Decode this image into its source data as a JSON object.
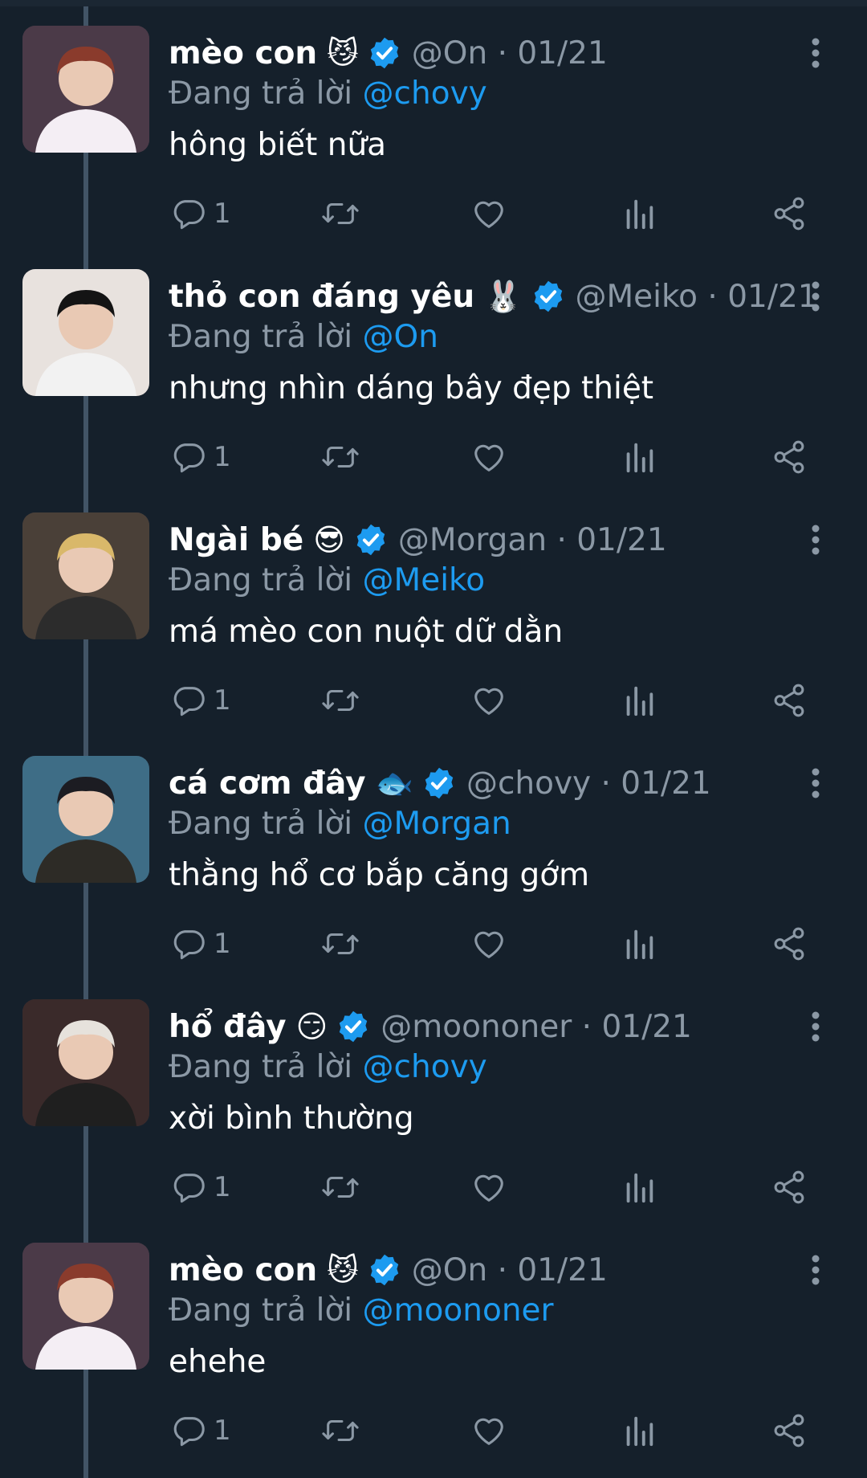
{
  "tweets": [
    {
      "name": "mèo con",
      "emoji": "😼",
      "handle": "@On",
      "date": "01/21",
      "replying_prefix": "Đang trả lời",
      "replying_to": "@chovy",
      "text": "hông biết nữa",
      "reply_count": "1"
    },
    {
      "name": "thỏ con đáng yêu",
      "emoji": "🐰",
      "handle": "@Meiko",
      "date": "01/21",
      "replying_prefix": "Đang trả lời",
      "replying_to": "@On",
      "text": "nhưng nhìn dáng bây đẹp thiệt",
      "reply_count": "1"
    },
    {
      "name": "Ngài bé",
      "emoji": "😎",
      "handle": "@Morgan",
      "date": "01/21",
      "replying_prefix": "Đang trả lời",
      "replying_to": "@Meiko",
      "text": "má mèo con nuột dữ dằn",
      "reply_count": "1"
    },
    {
      "name": "cá cơm đây",
      "emoji": "🐟",
      "handle": "@chovy",
      "date": "01/21",
      "replying_prefix": "Đang trả lời",
      "replying_to": "@Morgan",
      "text": "thằng hổ cơ bắp căng gớm",
      "reply_count": "1"
    },
    {
      "name": "hổ đây",
      "emoji": "😏",
      "handle": "@moononer",
      "date": "01/21",
      "replying_prefix": "Đang trả lời",
      "replying_to": "@chovy",
      "text": "xời bình thường",
      "reply_count": "1"
    },
    {
      "name": "mèo con",
      "emoji": "😼",
      "handle": "@On",
      "date": "01/21",
      "replying_prefix": "Đang trả lời",
      "replying_to": "@moononer",
      "text": "ehehe",
      "reply_count": "1"
    }
  ],
  "colors": {
    "background": "#15202b",
    "text": "#ffffff",
    "muted": "#8b98a5",
    "accent": "#1d9bf0",
    "thread_line": "#425466"
  },
  "icons": [
    "reply-icon",
    "retweet-icon",
    "like-icon",
    "views-icon",
    "share-icon",
    "more-icon",
    "verified-icon"
  ]
}
